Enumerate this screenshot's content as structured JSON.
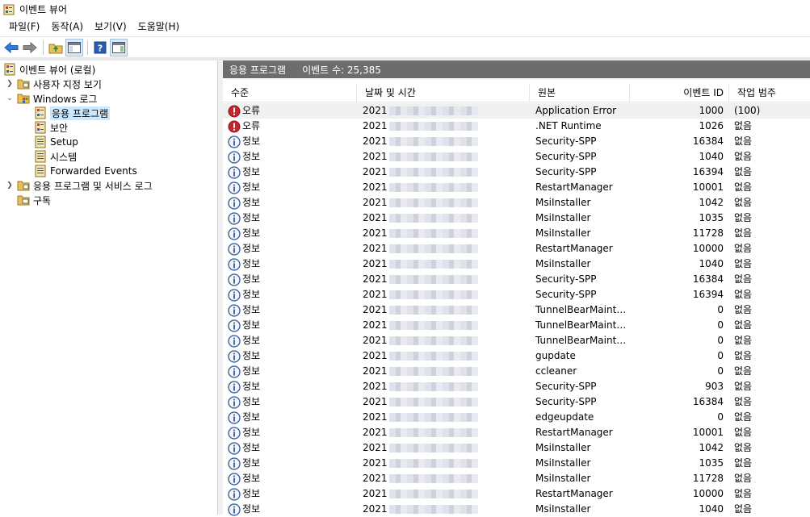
{
  "window": {
    "title": "이벤트 뷰어"
  },
  "menu": [
    "파일(F)",
    "동작(A)",
    "보기(V)",
    "도움말(H)"
  ],
  "toolbar": {
    "icons": [
      "back-arrow-icon",
      "forward-arrow-icon",
      "up-folder-icon",
      "show-hide-console-tree-icon",
      "help-icon",
      "show-hide-action-pane-icon"
    ]
  },
  "tree": {
    "root": "이벤트 뷰어 (로컬)",
    "custom_views": "사용자 지정 보기",
    "windows_logs": "Windows 로그",
    "application": "응용 프로그램",
    "security": "보안",
    "setup": "Setup",
    "system": "시스템",
    "forwarded": "Forwarded Events",
    "app_service_logs": "응용 프로그램 및 서비스 로그",
    "subscriptions": "구독"
  },
  "panel": {
    "title": "응용 프로그램",
    "count": "이벤트 수: 25,385"
  },
  "columns": [
    "수준",
    "날짜 및 시간",
    "원본",
    "이벤트 ID",
    "작업 범주"
  ],
  "colors": {
    "error": "#c4262e",
    "info": "#2b579a",
    "header_bg": "#6d6d6d",
    "selected": "#cce8ff"
  },
  "rows": [
    {
      "level": "오류",
      "type": "error",
      "date": "2021",
      "source": "Application Error",
      "id": "1000",
      "cat": "(100)"
    },
    {
      "level": "오류",
      "type": "error",
      "date": "2021",
      "source": ".NET Runtime",
      "id": "1026",
      "cat": "없음"
    },
    {
      "level": "정보",
      "type": "info",
      "date": "2021",
      "source": "Security-SPP",
      "id": "16384",
      "cat": "없음"
    },
    {
      "level": "정보",
      "type": "info",
      "date": "2021",
      "source": "Security-SPP",
      "id": "1040",
      "cat": "없음"
    },
    {
      "level": "정보",
      "type": "info",
      "date": "2021",
      "source": "Security-SPP",
      "id": "16394",
      "cat": "없음"
    },
    {
      "level": "정보",
      "type": "info",
      "date": "2021",
      "source": "RestartManager",
      "id": "10001",
      "cat": "없음"
    },
    {
      "level": "정보",
      "type": "info",
      "date": "2021",
      "source": "MsiInstaller",
      "id": "1042",
      "cat": "없음"
    },
    {
      "level": "정보",
      "type": "info",
      "date": "2021",
      "source": "MsiInstaller",
      "id": "1035",
      "cat": "없음"
    },
    {
      "level": "정보",
      "type": "info",
      "date": "2021",
      "source": "MsiInstaller",
      "id": "11728",
      "cat": "없음"
    },
    {
      "level": "정보",
      "type": "info",
      "date": "2021",
      "source": "RestartManager",
      "id": "10000",
      "cat": "없음"
    },
    {
      "level": "정보",
      "type": "info",
      "date": "2021",
      "source": "MsiInstaller",
      "id": "1040",
      "cat": "없음"
    },
    {
      "level": "정보",
      "type": "info",
      "date": "2021",
      "source": "Security-SPP",
      "id": "16384",
      "cat": "없음"
    },
    {
      "level": "정보",
      "type": "info",
      "date": "2021",
      "source": "Security-SPP",
      "id": "16394",
      "cat": "없음"
    },
    {
      "level": "정보",
      "type": "info",
      "date": "2021",
      "source": "TunnelBearMainten...",
      "id": "0",
      "cat": "없음"
    },
    {
      "level": "정보",
      "type": "info",
      "date": "2021",
      "source": "TunnelBearMainten...",
      "id": "0",
      "cat": "없음"
    },
    {
      "level": "정보",
      "type": "info",
      "date": "2021",
      "source": "TunnelBearMainten...",
      "id": "0",
      "cat": "없음"
    },
    {
      "level": "정보",
      "type": "info",
      "date": "2021",
      "source": "gupdate",
      "id": "0",
      "cat": "없음"
    },
    {
      "level": "정보",
      "type": "info",
      "date": "2021",
      "source": "ccleaner",
      "id": "0",
      "cat": "없음"
    },
    {
      "level": "정보",
      "type": "info",
      "date": "2021",
      "source": "Security-SPP",
      "id": "903",
      "cat": "없음"
    },
    {
      "level": "정보",
      "type": "info",
      "date": "2021",
      "source": "Security-SPP",
      "id": "16384",
      "cat": "없음"
    },
    {
      "level": "정보",
      "type": "info",
      "date": "2021",
      "source": "edgeupdate",
      "id": "0",
      "cat": "없음"
    },
    {
      "level": "정보",
      "type": "info",
      "date": "2021",
      "source": "RestartManager",
      "id": "10001",
      "cat": "없음"
    },
    {
      "level": "정보",
      "type": "info",
      "date": "2021",
      "source": "MsiInstaller",
      "id": "1042",
      "cat": "없음"
    },
    {
      "level": "정보",
      "type": "info",
      "date": "2021",
      "source": "MsiInstaller",
      "id": "1035",
      "cat": "없음"
    },
    {
      "level": "정보",
      "type": "info",
      "date": "2021",
      "source": "MsiInstaller",
      "id": "11728",
      "cat": "없음"
    },
    {
      "level": "정보",
      "type": "info",
      "date": "2021",
      "source": "RestartManager",
      "id": "10000",
      "cat": "없음"
    },
    {
      "level": "정보",
      "type": "info",
      "date": "2021",
      "source": "MsiInstaller",
      "id": "1040",
      "cat": "없음"
    }
  ]
}
